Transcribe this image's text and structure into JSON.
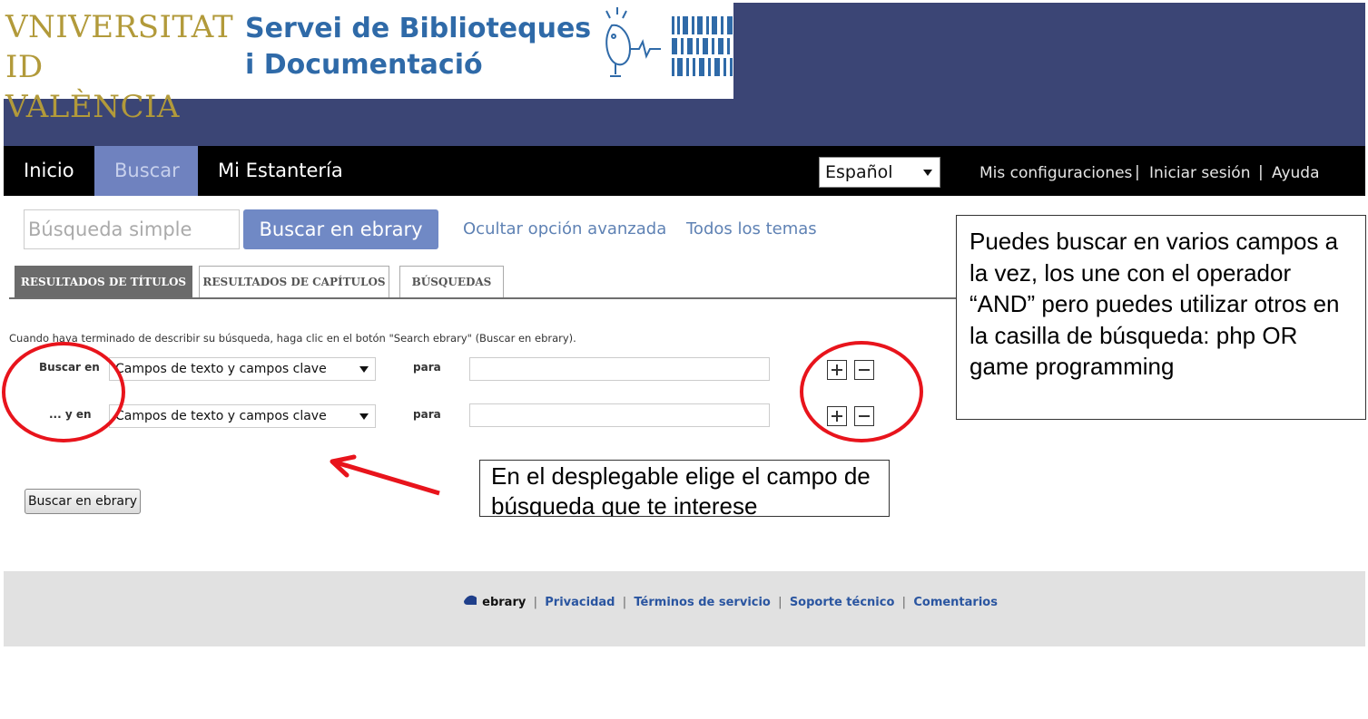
{
  "header": {
    "university_line1": "VNIVERSITAT",
    "university_line2": "ID VALÈNCIA",
    "service_line1": "Servei de Biblioteques",
    "service_line2": "i Documentació"
  },
  "nav": {
    "items": [
      {
        "label": "Inicio"
      },
      {
        "label": "Buscar",
        "active": true
      },
      {
        "label": "Mi Estantería"
      }
    ],
    "language": "Español",
    "links": [
      "Mis configuraciones",
      "Iniciar sesión",
      "Ayuda"
    ],
    "separator": "|"
  },
  "search": {
    "placeholder": "Búsqueda simple",
    "button": "Buscar en ebrary",
    "hide_advanced": "Ocultar opción avanzada",
    "all_topics": "Todos los temas"
  },
  "tabs": [
    "RESULTADOS DE TÍTULOS",
    "RESULTADOS DE CAPÍTULOS",
    "BÚSQUEDAS"
  ],
  "form": {
    "instructions": "Cuando haya terminado de describir su búsqueda, haga clic en el botón \"Search ebrary\" (Buscar en ebrary).",
    "rows": [
      {
        "label": "Buscar en",
        "field": "Campos de texto y campos clave",
        "para": "para"
      },
      {
        "label": "... y en",
        "field": "Campos de texto y campos clave",
        "para": "para"
      }
    ],
    "submit": "Buscar en ebrary"
  },
  "annotations": {
    "right": "Puedes buscar en varios campos a la vez, los une con el operador “AND” pero puedes utilizar otros en la casilla de búsqueda: php OR game programming",
    "bottom": "En el desplegable elige el campo de búsqueda que te interese",
    "color": "#e8141c"
  },
  "footer": {
    "logo": "ebrary",
    "links": [
      "Privacidad",
      "Términos de servicio",
      "Soporte técnico",
      "Comentarios"
    ]
  },
  "colors": {
    "banner": "#3b4575",
    "nav_bg": "#000000",
    "nav_active": "#6f82bf",
    "accent_button": "#7089c5",
    "link": "#5f82b4",
    "footer_bg": "#e1e1e1"
  }
}
